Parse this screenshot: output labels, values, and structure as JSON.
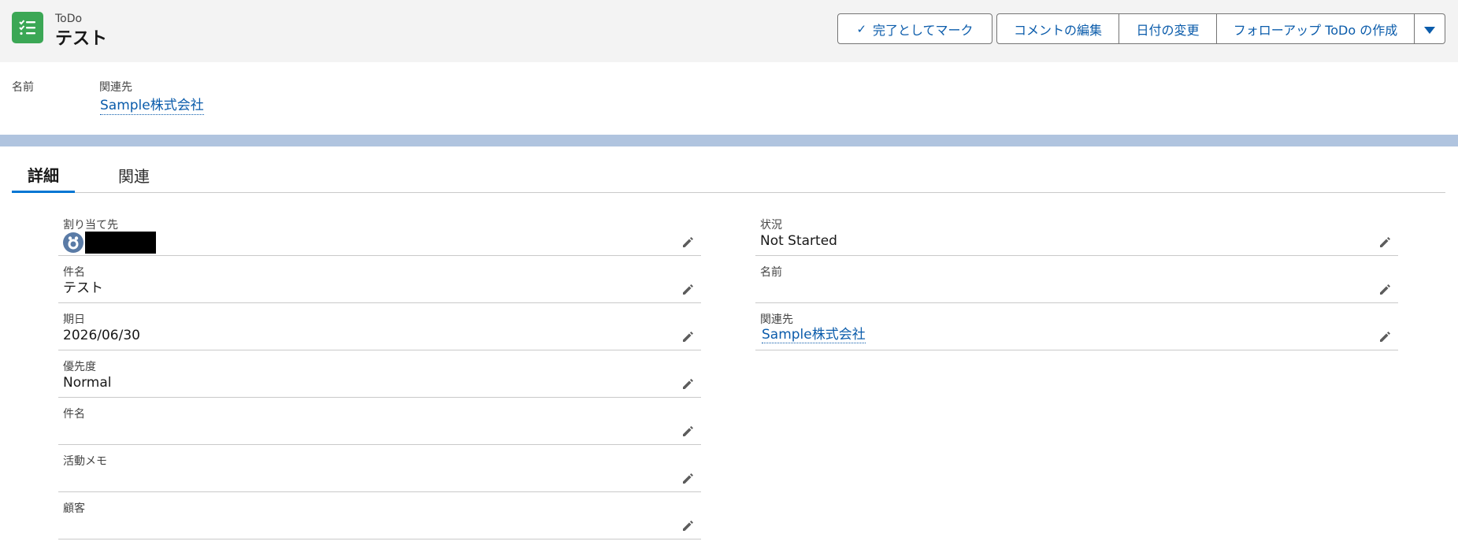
{
  "header": {
    "object_label": "ToDo",
    "record_title": "テスト",
    "icon": "task-checklist-icon",
    "icon_color": "#3ba755"
  },
  "actions": {
    "mark_complete": "完了としてマーク",
    "edit_comments": "コメントの編集",
    "change_date": "日付の変更",
    "create_followup": "フォローアップ ToDo の作成",
    "more_icon": "chevron-down-icon"
  },
  "highlights": {
    "name_label": "名前",
    "related_label": "関連先",
    "related_value": "Sample株式会社"
  },
  "tabs": {
    "details": "詳細",
    "related": "関連"
  },
  "fields_left": [
    {
      "label": "割り当て先",
      "value": ""
    },
    {
      "label": "件名",
      "value": "テスト"
    },
    {
      "label": "期日",
      "value": "2026/06/30"
    },
    {
      "label": "優先度",
      "value": "Normal"
    },
    {
      "label": "件名",
      "value": ""
    },
    {
      "label": "活動メモ",
      "value": ""
    },
    {
      "label": "顧客",
      "value": ""
    }
  ],
  "fields_right": [
    {
      "label": "状況",
      "value": "Not Started"
    },
    {
      "label": "名前",
      "value": ""
    },
    {
      "label": "関連先",
      "value": "Sample株式会社"
    }
  ],
  "colors": {
    "link": "#0b5cab",
    "brand": "#0176d3",
    "band": "#b0c4df",
    "header_bg": "#f3f3f3"
  }
}
